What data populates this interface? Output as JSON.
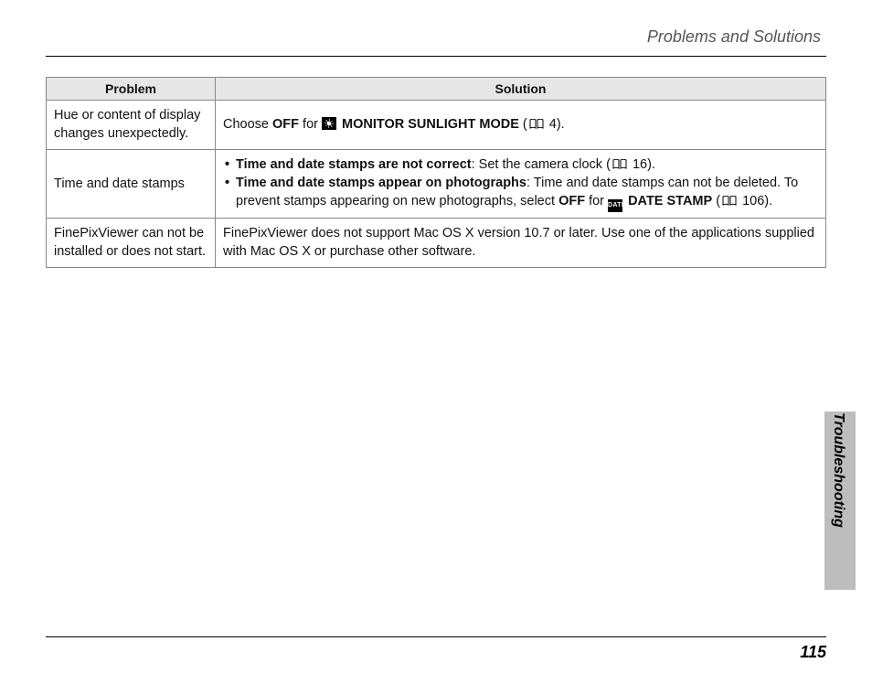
{
  "header_title": "Problems and Solutions",
  "section_tab": "Troubleshooting",
  "page_number": "115",
  "table": {
    "col_problem": "Problem",
    "col_solution": "Solution",
    "rows": [
      {
        "problem": "Hue or content of display changes unexpectedly.",
        "sol_prefix": "Choose ",
        "sol_bold_off": "OFF",
        "sol_mid": " for ",
        "sol_mode": " MONITOR SUNLIGHT MODE",
        "sol_suffix": " (",
        "sol_pg": " 4).",
        "page_ref": "4"
      },
      {
        "problem": "Time and date stamps",
        "b1_bold": "Time and date stamps are not correct",
        "b1_rest": ": Set the camera clock (",
        "b1_pg": " 16).",
        "b2_bold": "Time and date stamps appear on photographs",
        "b2_rest": ": Time and date stamps can not be deleted.  To prevent stamps appearing on new photographs, select ",
        "b2_off": "OFF",
        "b2_for": " for ",
        "b2_mode": " DATE STAMP",
        "b2_suffix": " (",
        "b2_pg": " 106)."
      },
      {
        "problem": "FinePixViewer can not be installed or does not start.",
        "solution": "FinePixViewer does not support Mac OS X version 10.7 or later.  Use one of the applications supplied with Mac OS X or purchase other software."
      }
    ]
  }
}
